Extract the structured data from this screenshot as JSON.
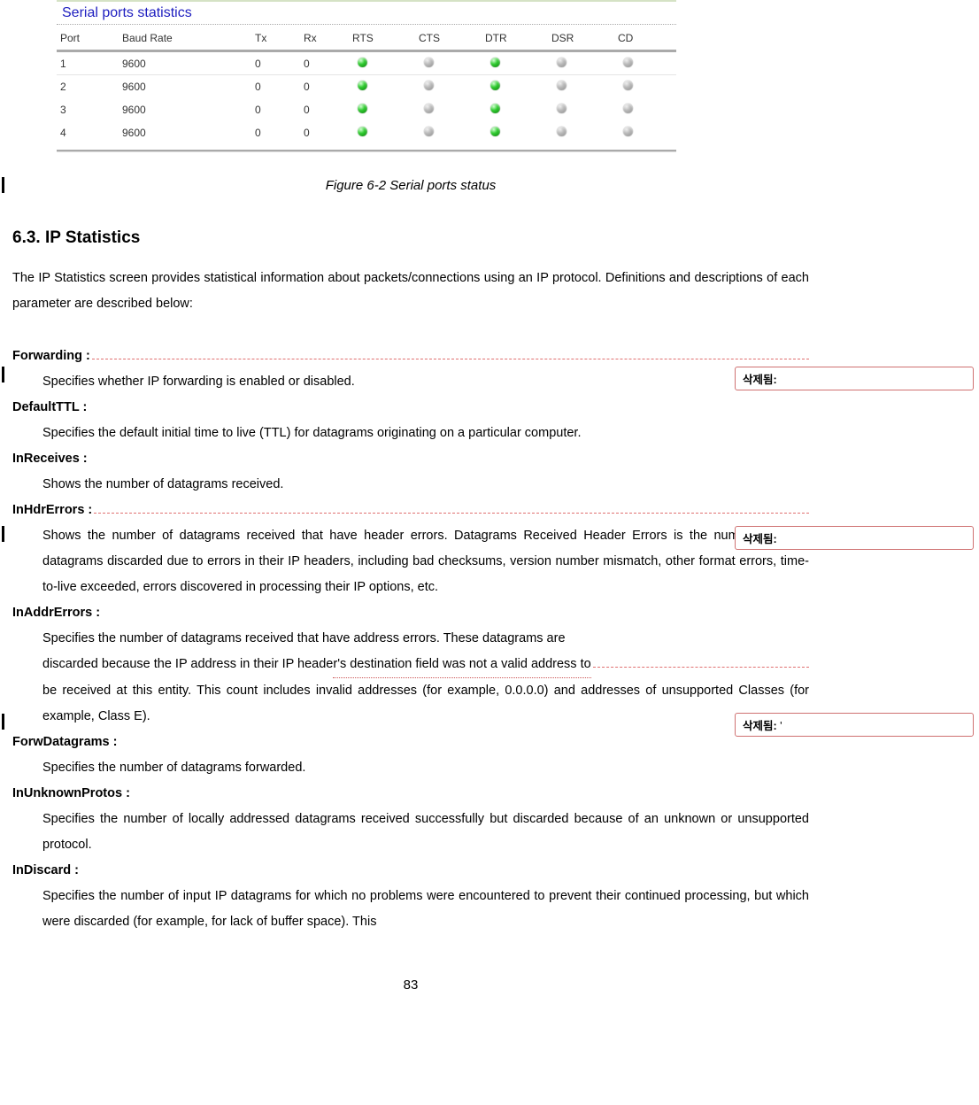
{
  "panel": {
    "title": "Serial ports statistics",
    "headers": [
      "Port",
      "Baud Rate",
      "Tx",
      "Rx",
      "RTS",
      "CTS",
      "DTR",
      "DSR",
      "CD"
    ],
    "rows": [
      {
        "port": "1",
        "baud": "9600",
        "tx": "0",
        "rx": "0",
        "rts": "green",
        "cts": "grey",
        "dtr": "green",
        "dsr": "grey",
        "cd": "grey"
      },
      {
        "port": "2",
        "baud": "9600",
        "tx": "0",
        "rx": "0",
        "rts": "green",
        "cts": "grey",
        "dtr": "green",
        "dsr": "grey",
        "cd": "grey"
      },
      {
        "port": "3",
        "baud": "9600",
        "tx": "0",
        "rx": "0",
        "rts": "green",
        "cts": "grey",
        "dtr": "green",
        "dsr": "grey",
        "cd": "grey"
      },
      {
        "port": "4",
        "baud": "9600",
        "tx": "0",
        "rx": "0",
        "rts": "green",
        "cts": "grey",
        "dtr": "green",
        "dsr": "grey",
        "cd": "grey"
      }
    ]
  },
  "caption": "Figure 6-2 Serial ports status",
  "section_title": "6.3. IP Statistics",
  "intro": "The IP Statistics screen provides statistical information about packets/connections using an IP protocol. Definitions and descriptions of each parameter are described below:",
  "definitions": [
    {
      "term": "Forwarding :",
      "desc": "Specifies whether IP forwarding is enabled or disabled."
    },
    {
      "term": "DefaultTTL :",
      "desc": "Specifies the default initial time to live (TTL) for datagrams originating on a particular computer."
    },
    {
      "term": "InReceives :",
      "desc": "Shows the number of datagrams received."
    },
    {
      "term": "InHdrErrors :",
      "desc": "Shows the number of datagrams received that have header errors. Datagrams Received Header Errors is the number of input datagrams discarded due to errors in their IP headers, including bad checksums, version number mismatch, other format errors, time-to-live exceeded, errors discovered in processing their IP options, etc."
    },
    {
      "term": "InAddrErrors :",
      "desc": "Specifies the number of datagrams received that have address errors. These datagrams are discarded because the IP address in their IP header's destination field was not a valid address to be received at this entity. This count includes invalid addresses (for example, 0.0.0.0) and addresses of unsupported Classes (for example, Class E).",
      "mark_seg_a": "discarded because the IP address in their IP heade",
      "mark_seg_b": "r's destination field was not a valid address to"
    },
    {
      "term": "ForwDatagrams :",
      "desc": "Specifies the number of datagrams forwarded."
    },
    {
      "term": "InUnknownProtos :",
      "desc": "Specifies the number of locally addressed datagrams received successfully but discarded because of an unknown or unsupported protocol."
    },
    {
      "term": "InDiscard :",
      "desc": "Specifies the number of input IP datagrams for which no problems were encountered to prevent their continued processing, but which were discarded (for example, for lack of buffer space). This"
    }
  ],
  "comments": {
    "label": "삭제됨:",
    "c1_extra": "",
    "c2_extra": "",
    "c3_extra": " '"
  },
  "page_number": "83"
}
